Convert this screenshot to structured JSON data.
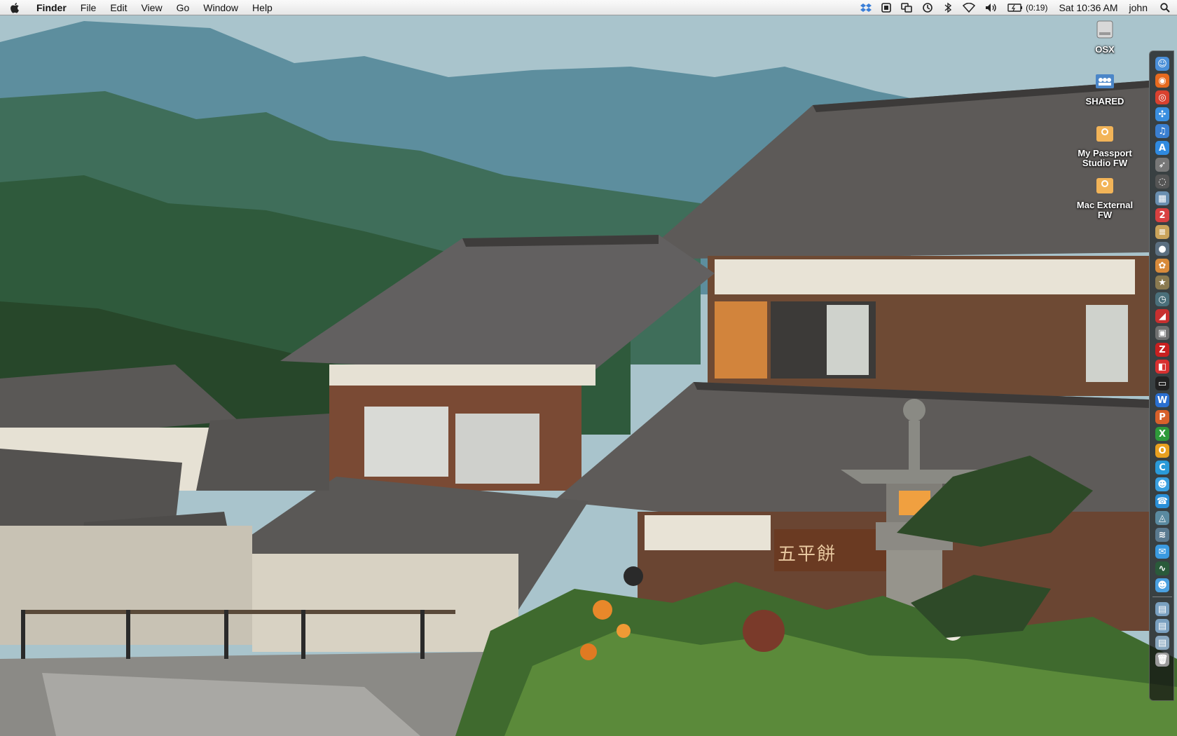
{
  "menubar": {
    "app_name": "Finder",
    "menus": [
      "File",
      "Edit",
      "View",
      "Go",
      "Window",
      "Help"
    ],
    "battery_time": "(0:19)",
    "clock": "Sat 10:36 AM",
    "user": "john",
    "status_icons": [
      "dropbox-icon",
      "menu-extra-icon",
      "sync-icon",
      "time-machine-icon",
      "bluetooth-icon",
      "wifi-icon",
      "volume-icon",
      "battery-icon"
    ]
  },
  "desktop": {
    "wallpaper": "japanese-village-mountains",
    "sign_text": "五平餅",
    "icons": [
      {
        "label": "OSX",
        "icon": "hard-disk-icon"
      },
      {
        "label": "SHARED",
        "icon": "network-share-icon"
      },
      {
        "label": "My Passport Studio FW",
        "icon": "external-drive-icon"
      },
      {
        "label": "Mac External FW",
        "icon": "external-drive-icon"
      }
    ]
  },
  "dock": {
    "position": "right",
    "items": [
      {
        "name": "finder",
        "glyph": "☺",
        "color": "#4a8fd8"
      },
      {
        "name": "firefox",
        "glyph": "◉",
        "color": "#e66a1f"
      },
      {
        "name": "chrome",
        "glyph": "◎",
        "color": "#d8412f"
      },
      {
        "name": "safari",
        "glyph": "✣",
        "color": "#3a8fe0"
      },
      {
        "name": "itunes",
        "glyph": "♫",
        "color": "#3a7fd0"
      },
      {
        "name": "app-store",
        "glyph": "A",
        "color": "#2f8ae0"
      },
      {
        "name": "rocket",
        "glyph": "➶",
        "color": "#777777"
      },
      {
        "name": "aperture",
        "glyph": "◌",
        "color": "#555555"
      },
      {
        "name": "preview",
        "glyph": "▦",
        "color": "#6a8fb0"
      },
      {
        "name": "ical",
        "glyph": "2",
        "color": "#d84040"
      },
      {
        "name": "notes",
        "glyph": "≡",
        "color": "#c9a35a"
      },
      {
        "name": "facetime",
        "glyph": "●",
        "color": "#5b6f80"
      },
      {
        "name": "iphoto",
        "glyph": "✿",
        "color": "#d88a3a"
      },
      {
        "name": "imovie",
        "glyph": "★",
        "color": "#8a7a50"
      },
      {
        "name": "time-machine",
        "glyph": "◷",
        "color": "#4a6f7a"
      },
      {
        "name": "textmate",
        "glyph": "◢",
        "color": "#c82f2f"
      },
      {
        "name": "screenshot",
        "glyph": "▣",
        "color": "#707070"
      },
      {
        "name": "filezilla",
        "glyph": "Z",
        "color": "#c82020"
      },
      {
        "name": "parallels",
        "glyph": "◧",
        "color": "#d83030"
      },
      {
        "name": "terminal",
        "glyph": "▭",
        "color": "#222222"
      },
      {
        "name": "word",
        "glyph": "W",
        "color": "#2a6fd0"
      },
      {
        "name": "powerpoint",
        "glyph": "P",
        "color": "#d8602a"
      },
      {
        "name": "excel",
        "glyph": "X",
        "color": "#2e9a3a"
      },
      {
        "name": "outlook",
        "glyph": "O",
        "color": "#e8a020"
      },
      {
        "name": "entourage",
        "glyph": "C",
        "color": "#2a9ad8"
      },
      {
        "name": "messenger",
        "glyph": "☻",
        "color": "#3aa0e0"
      },
      {
        "name": "skype",
        "glyph": "☎",
        "color": "#2a90d8"
      },
      {
        "name": "airport",
        "glyph": "◬",
        "color": "#5a8aa0"
      },
      {
        "name": "network",
        "glyph": "≋",
        "color": "#5a7a90"
      },
      {
        "name": "ichat",
        "glyph": "✉",
        "color": "#3a9ae0"
      },
      {
        "name": "activity-monitor",
        "glyph": "∿",
        "color": "#2a5a3a"
      },
      {
        "name": "adium",
        "glyph": "☻",
        "color": "#4aa0e0"
      },
      {
        "name": "applications-folder",
        "glyph": "▤",
        "color": "#7aa0c0"
      },
      {
        "name": "documents-folder",
        "glyph": "▤",
        "color": "#7aa0c0"
      },
      {
        "name": "downloads-stack",
        "glyph": "▤",
        "color": "#8aa8c0"
      },
      {
        "name": "trash",
        "glyph": "🗑",
        "color": "#9a9a9a"
      }
    ]
  }
}
